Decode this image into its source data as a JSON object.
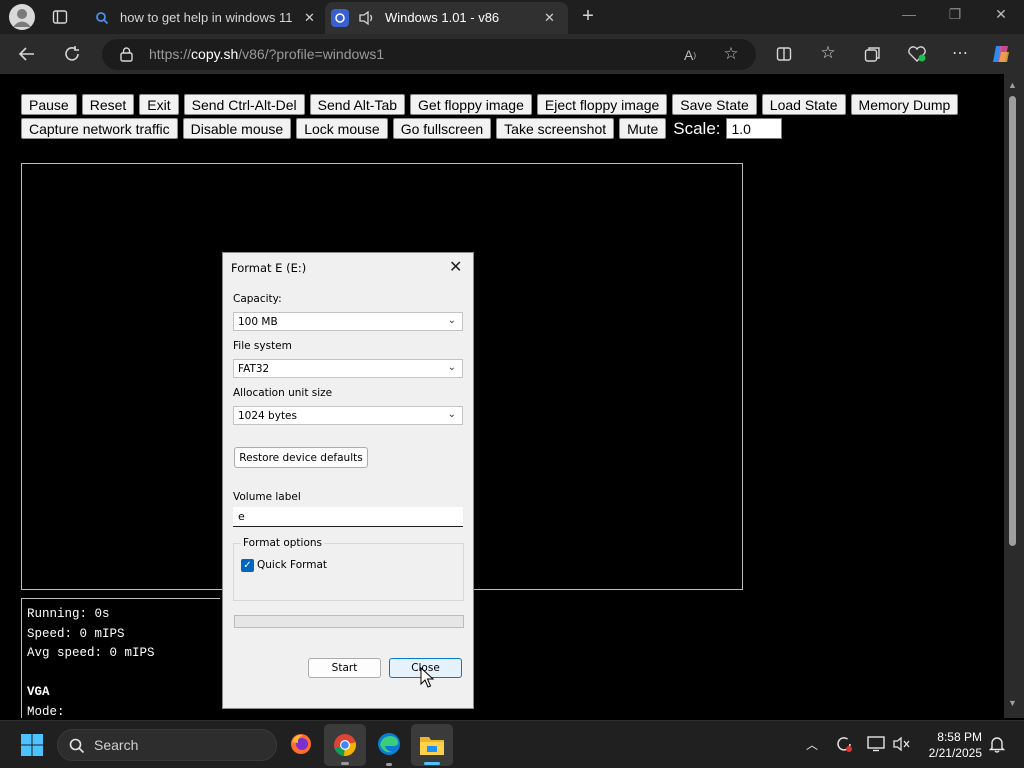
{
  "browser": {
    "tabs": [
      {
        "title": "how to get help in windows 11 -",
        "icon": "search-icon",
        "active": false
      },
      {
        "title": "Windows 1.01 - v86",
        "icon": "v86-icon",
        "active": true
      }
    ],
    "url_prefix": "https://",
    "url_domain": "copy.sh",
    "url_path": "/v86/?profile=windows1"
  },
  "controls": {
    "row1": [
      "Pause",
      "Reset",
      "Exit",
      "Send Ctrl-Alt-Del",
      "Send Alt-Tab",
      "Get floppy image",
      "Eject floppy image",
      "Save State",
      "Load State",
      "Memory Dump"
    ],
    "row2": [
      "Capture network traffic",
      "Disable mouse",
      "Lock mouse",
      "Go fullscreen",
      "Take screenshot",
      "Mute"
    ],
    "scale_label": "Scale:",
    "scale_value": "1.0"
  },
  "stats": {
    "running": "Running: 0s",
    "speed": "Speed: 0 mIPS",
    "avg_speed": "Avg speed: 0 mIPS",
    "vga": "VGA",
    "mode": "Mode:"
  },
  "dialog": {
    "title": "Format E (E:)",
    "capacity_label": "Capacity:",
    "capacity_value": "100 MB",
    "fs_label": "File system",
    "fs_value": "FAT32",
    "alloc_label": "Allocation unit size",
    "alloc_value": "1024 bytes",
    "restore_button": "Restore device defaults",
    "volume_label": "Volume label",
    "volume_value": "e",
    "format_options": "Format options",
    "quick_format": "Quick Format",
    "quick_format_checked": true,
    "progress": 0,
    "start_button": "Start",
    "close_button": "Close"
  },
  "taskbar": {
    "search_label": "Search",
    "time": "8:58 PM",
    "date": "2/21/2025"
  },
  "colors": {
    "accent": "#0067c0",
    "chrome_dark": "#1f1f1f",
    "taskbar": "#202020"
  }
}
